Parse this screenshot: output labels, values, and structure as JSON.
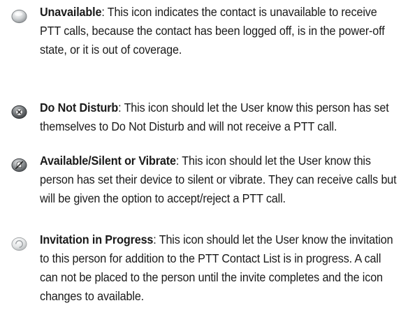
{
  "entries": [
    {
      "icon": "unavailable-status-icon",
      "term": "Unavailable",
      "description": ": This icon indicates the contact is unavailable to receive PTT calls, because the contact has been logged off, is in the power-off state, or it is out of coverage."
    },
    {
      "icon": "do-not-disturb-status-icon",
      "term": "Do Not Disturb",
      "description": ": This icon should let the User know this person has set themselves to Do Not Disturb and will not receive a PTT call."
    },
    {
      "icon": "silent-vibrate-status-icon",
      "term": "Available/Silent or Vibrate",
      "description": ": This icon should let the User know this person has set their device to silent or vibrate. They can receive calls but will be given the option to accept/reject a PTT call."
    },
    {
      "icon": "invitation-in-progress-status-icon",
      "term": "Invitation in Progress",
      "description": ": This icon should let the User know the invitation to this person for addition to the PTT Contact List is in progress. A call can not be placed to the person until the invite completes and the icon changes to available."
    }
  ]
}
